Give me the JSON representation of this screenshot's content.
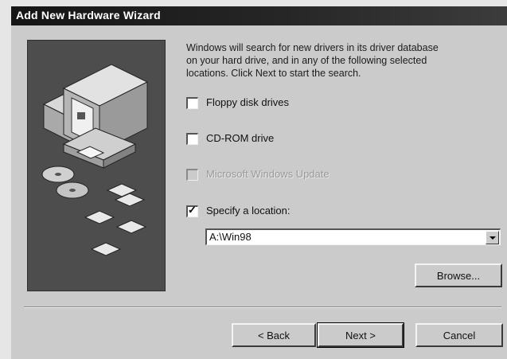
{
  "window": {
    "title": "Add New Hardware Wizard"
  },
  "description": {
    "lines": [
      "Windows will search for new drivers in its driver database",
      "on your hard drive, and in any of the following selected",
      "locations. Click Next to start the search."
    ]
  },
  "options": {
    "floppy": {
      "label": "Floppy disk drives",
      "checked": false,
      "enabled": true
    },
    "cdrom": {
      "label": "CD-ROM drive",
      "checked": false,
      "enabled": true
    },
    "windows_update": {
      "label": "Microsoft Windows Update",
      "checked": false,
      "enabled": false
    },
    "location": {
      "label": "Specify a location:",
      "checked": true,
      "enabled": true
    }
  },
  "location_field": {
    "value": "A:\\Win98"
  },
  "buttons": {
    "browse": "Browse...",
    "back": "< Back",
    "next": "Next >",
    "cancel": "Cancel"
  },
  "icons": [
    "computer-icon",
    "cd-disc-icon",
    "driver-disk-icon",
    "dropdown-arrow-icon"
  ]
}
